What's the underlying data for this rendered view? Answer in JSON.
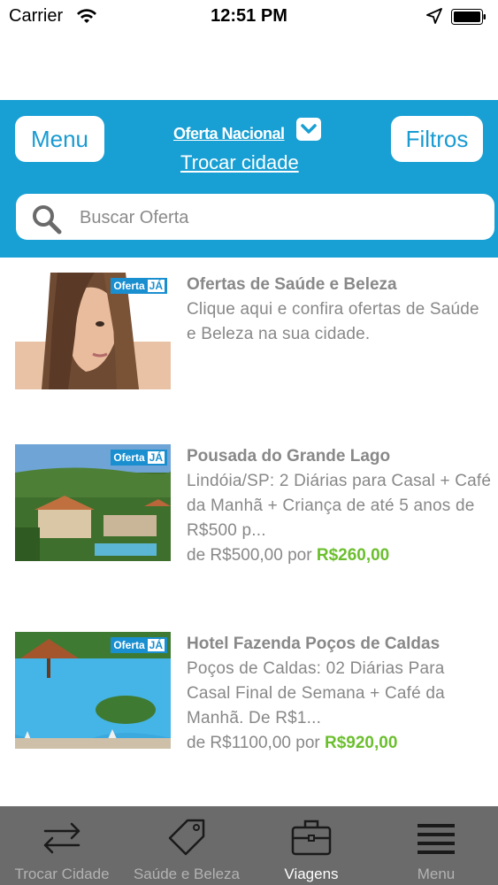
{
  "status_bar": {
    "carrier": "Carrier",
    "time": "12:51 PM",
    "wifi_icon": "wifi-icon",
    "location_icon": "location-arrow-icon",
    "battery_icon": "battery-icon"
  },
  "header": {
    "background_color": "#189fd3",
    "menu_label": "Menu",
    "filters_label": "Filtros",
    "city_title": "Oferta Nacional",
    "change_city_label": "Trocar cidade",
    "chevron_icon": "chevron-down-icon"
  },
  "search": {
    "placeholder": "Buscar Oferta",
    "value": "",
    "icon": "search-icon"
  },
  "offers": [
    {
      "title": "Ofertas de Saúde e Beleza",
      "description": "Clique aqui e confira ofertas de Saúde e Beleza na sua cidade.",
      "badge": "Oferta",
      "badge_suffix": "JÁ"
    },
    {
      "title": "Pousada do Grande Lago",
      "description": "Lindóia/SP: 2 Diárias para Casal + Café da Manhã + Criança de até 5 anos de R$500 p...",
      "price_old_prefix": "de R$500,00 por",
      "price_new": "R$260,00",
      "badge": "Oferta",
      "badge_suffix": "JÁ"
    },
    {
      "title": "Hotel Fazenda Poços de Caldas",
      "description": "Poços de Caldas: 02 Diárias Para Casal Final de Semana + Café da Manhã. De R$1...",
      "price_old_prefix": "de R$1100,00 por",
      "price_new": "R$920,00",
      "badge": "Oferta",
      "badge_suffix": "JÁ"
    }
  ],
  "tab_bar": {
    "tabs": [
      {
        "label": "Trocar Cidade",
        "icon": "swap-arrows-icon",
        "active": false
      },
      {
        "label": "Saúde e Beleza",
        "icon": "tag-icon",
        "active": false
      },
      {
        "label": "Viagens",
        "icon": "briefcase-icon",
        "active": true
      },
      {
        "label": "Menu",
        "icon": "menu-lines-icon",
        "active": false
      }
    ],
    "active_color": "#ffffff",
    "inactive_color": "#b3b3b3"
  },
  "colors": {
    "price_new": "#6bbf2e",
    "text_gray": "#888888"
  }
}
